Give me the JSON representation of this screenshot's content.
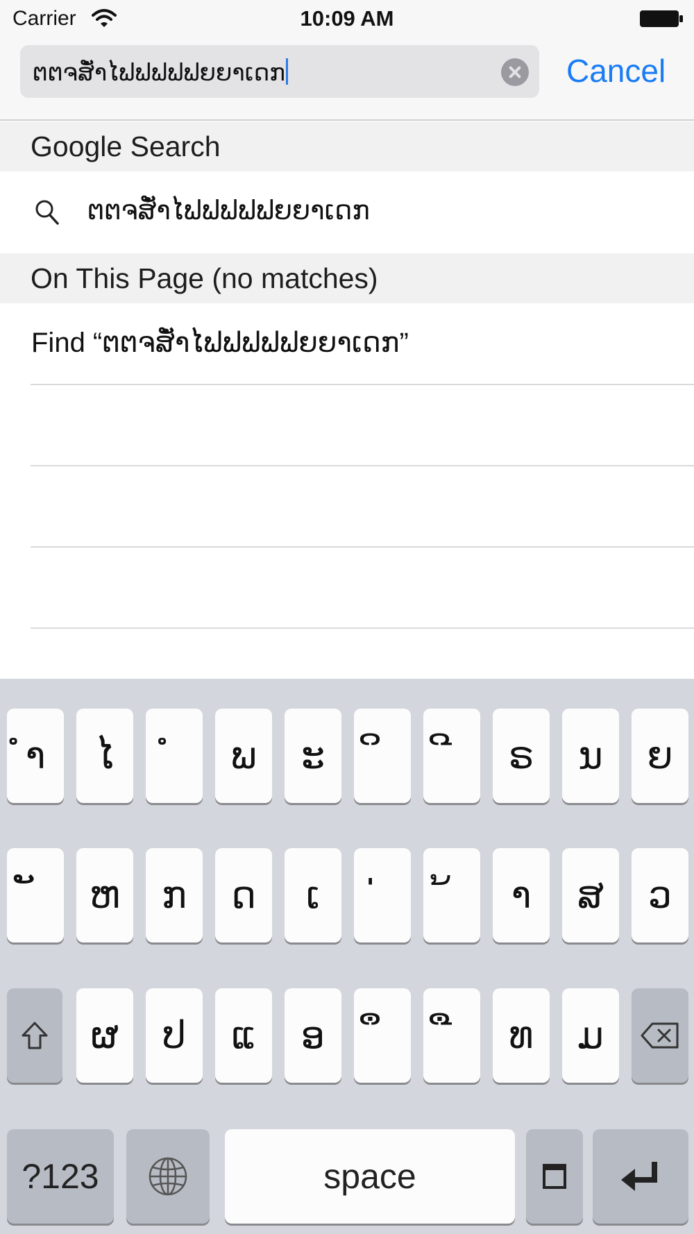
{
  "status_bar": {
    "carrier": "Carrier",
    "time": "10:09 AM"
  },
  "search": {
    "value": "ຕຕຈສັ່ໍາໄຟຟຟຟຟຍຍາເດກ",
    "cancel_label": "Cancel"
  },
  "results": {
    "google_header": "Google Search",
    "suggestion_text": "ຕຕຈສັ່ໍາໄຟຟຟຟຟຍຍາເດກ",
    "on_page_header": "On This Page (no matches)",
    "find_text": "Find “ຕຕຈສັ່ໍາໄຟຟຟຟຟຍຍາເດກ”"
  },
  "keyboard": {
    "row1": [
      "ຳ",
      "ໄ",
      "ໍ",
      "ພ",
      "ະ",
      "ິ",
      "ີ",
      "ຣ",
      "ນ",
      "ຍ"
    ],
    "row2": [
      "ັ",
      "ຫ",
      "ກ",
      "ດ",
      "ເ",
      "່",
      "້",
      "າ",
      "ສ",
      "ວ"
    ],
    "row3": [
      "ຜ",
      "ປ",
      "ແ",
      "ອ",
      "ຶ",
      "ື",
      "ທ",
      "ມ"
    ],
    "numbers_label": "?123",
    "space_label": "space",
    "icons": {
      "shift": "shift-icon",
      "backspace": "backspace-icon",
      "globe": "globe-icon",
      "return": "return-icon",
      "dictation": "square-icon"
    }
  },
  "colors": {
    "accent": "#1a7cf5",
    "keyboard_bg": "#d3d6dc",
    "section_bg": "#f1f1f2"
  }
}
